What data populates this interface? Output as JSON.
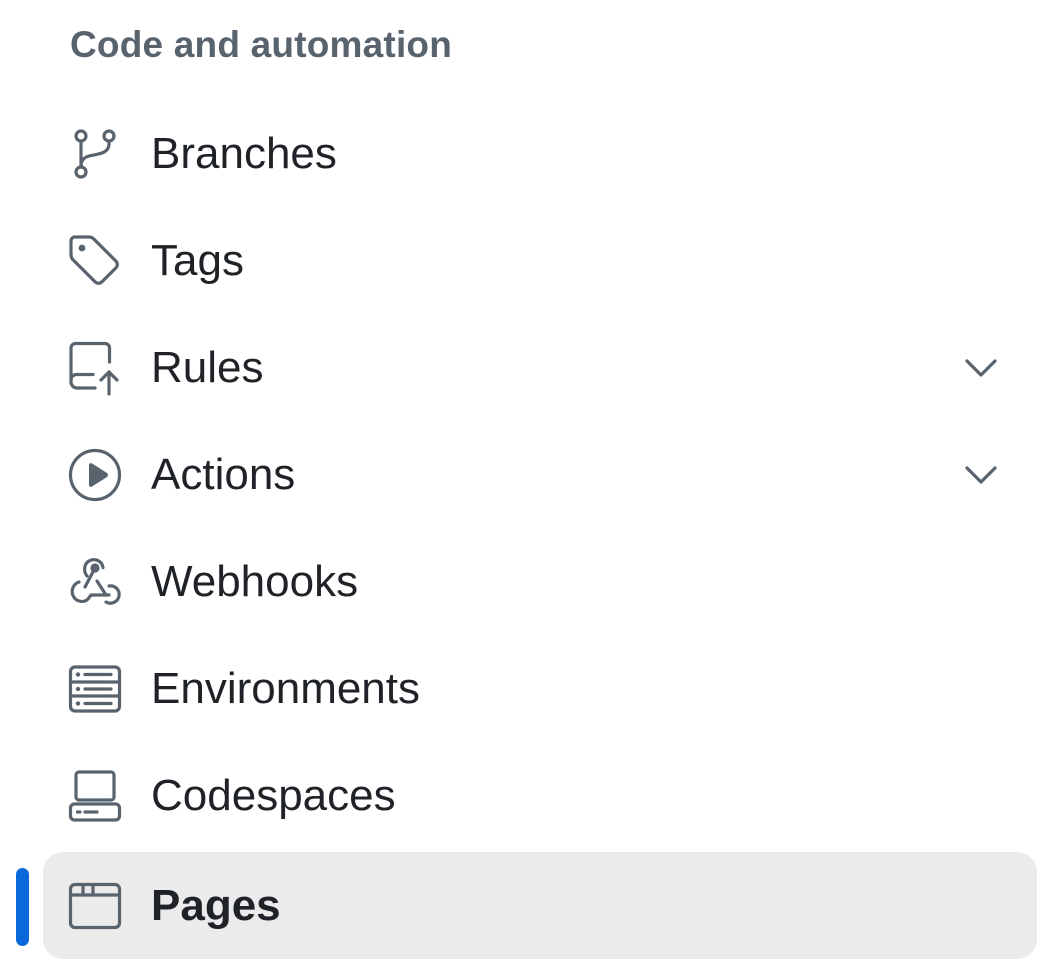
{
  "section": {
    "title": "Code and automation"
  },
  "nav": {
    "items": [
      {
        "label": "Branches",
        "icon": "git-branch-icon",
        "has_chevron": false,
        "active": false
      },
      {
        "label": "Tags",
        "icon": "tag-icon",
        "has_chevron": false,
        "active": false
      },
      {
        "label": "Rules",
        "icon": "repo-push-icon",
        "has_chevron": true,
        "active": false
      },
      {
        "label": "Actions",
        "icon": "play-icon",
        "has_chevron": true,
        "active": false
      },
      {
        "label": "Webhooks",
        "icon": "webhook-icon",
        "has_chevron": false,
        "active": false
      },
      {
        "label": "Environments",
        "icon": "server-icon",
        "has_chevron": false,
        "active": false
      },
      {
        "label": "Codespaces",
        "icon": "codespaces-icon",
        "has_chevron": false,
        "active": false
      },
      {
        "label": "Pages",
        "icon": "browser-icon",
        "has_chevron": false,
        "active": true
      }
    ]
  },
  "colors": {
    "accent": "#0969da",
    "active_background": "#ebebeb",
    "icon": "#59636e",
    "text": "#1f2328",
    "section_title": "#59636e"
  }
}
